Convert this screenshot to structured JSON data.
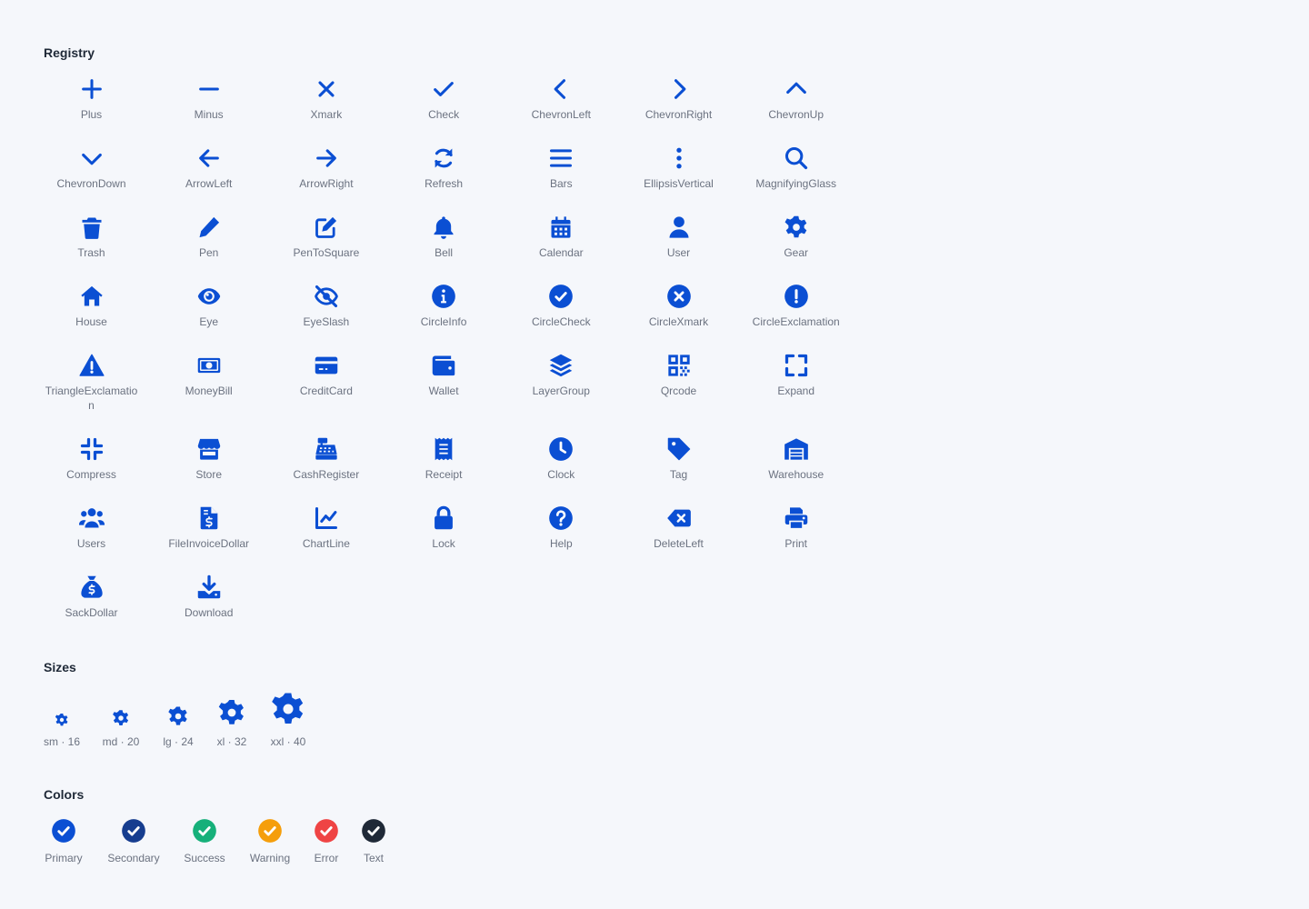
{
  "sections": {
    "registry": "Registry",
    "sizes": "Sizes",
    "colors": "Colors"
  },
  "icon_color": "#0b4fd3",
  "registry": [
    {
      "label": "Plus",
      "icon": "plus-icon"
    },
    {
      "label": "Minus",
      "icon": "minus-icon"
    },
    {
      "label": "Xmark",
      "icon": "xmark-icon"
    },
    {
      "label": "Check",
      "icon": "check-icon"
    },
    {
      "label": "ChevronLeft",
      "icon": "chevron-left-icon"
    },
    {
      "label": "ChevronRight",
      "icon": "chevron-right-icon"
    },
    {
      "label": "ChevronUp",
      "icon": "chevron-up-icon"
    },
    {
      "label": "ChevronDown",
      "icon": "chevron-down-icon"
    },
    {
      "label": "ArrowLeft",
      "icon": "arrow-left-icon"
    },
    {
      "label": "ArrowRight",
      "icon": "arrow-right-icon"
    },
    {
      "label": "Refresh",
      "icon": "refresh-icon"
    },
    {
      "label": "Bars",
      "icon": "bars-icon"
    },
    {
      "label": "EllipsisVertical",
      "icon": "ellipsis-vertical-icon"
    },
    {
      "label": "MagnifyingGlass",
      "icon": "magnifying-glass-icon"
    },
    {
      "label": "Trash",
      "icon": "trash-icon"
    },
    {
      "label": "Pen",
      "icon": "pen-icon"
    },
    {
      "label": "PenToSquare",
      "icon": "pen-to-square-icon"
    },
    {
      "label": "Bell",
      "icon": "bell-icon"
    },
    {
      "label": "Calendar",
      "icon": "calendar-icon"
    },
    {
      "label": "User",
      "icon": "user-icon"
    },
    {
      "label": "Gear",
      "icon": "gear-icon"
    },
    {
      "label": "House",
      "icon": "house-icon"
    },
    {
      "label": "Eye",
      "icon": "eye-icon"
    },
    {
      "label": "EyeSlash",
      "icon": "eye-slash-icon"
    },
    {
      "label": "CircleInfo",
      "icon": "circle-info-icon"
    },
    {
      "label": "CircleCheck",
      "icon": "circle-check-icon"
    },
    {
      "label": "CircleXmark",
      "icon": "circle-xmark-icon"
    },
    {
      "label": "CircleExclamation",
      "icon": "circle-exclamation-icon"
    },
    {
      "label": "TriangleExclamation",
      "icon": "triangle-exclamation-icon"
    },
    {
      "label": "MoneyBill",
      "icon": "money-bill-icon"
    },
    {
      "label": "CreditCard",
      "icon": "credit-card-icon"
    },
    {
      "label": "Wallet",
      "icon": "wallet-icon"
    },
    {
      "label": "LayerGroup",
      "icon": "layer-group-icon"
    },
    {
      "label": "Qrcode",
      "icon": "qrcode-icon"
    },
    {
      "label": "Expand",
      "icon": "expand-icon"
    },
    {
      "label": "Compress",
      "icon": "compress-icon"
    },
    {
      "label": "Store",
      "icon": "store-icon"
    },
    {
      "label": "CashRegister",
      "icon": "cash-register-icon"
    },
    {
      "label": "Receipt",
      "icon": "receipt-icon"
    },
    {
      "label": "Clock",
      "icon": "clock-icon"
    },
    {
      "label": "Tag",
      "icon": "tag-icon"
    },
    {
      "label": "Warehouse",
      "icon": "warehouse-icon"
    },
    {
      "label": "Users",
      "icon": "users-icon"
    },
    {
      "label": "FileInvoiceDollar",
      "icon": "file-invoice-dollar-icon"
    },
    {
      "label": "ChartLine",
      "icon": "chart-line-icon"
    },
    {
      "label": "Lock",
      "icon": "lock-icon"
    },
    {
      "label": "Help",
      "icon": "help-icon"
    },
    {
      "label": "DeleteLeft",
      "icon": "delete-left-icon"
    },
    {
      "label": "Print",
      "icon": "print-icon"
    },
    {
      "label": "SackDollar",
      "icon": "sack-dollar-icon"
    },
    {
      "label": "Download",
      "icon": "download-icon"
    }
  ],
  "sizes": [
    {
      "label": "sm · 16",
      "size": 16
    },
    {
      "label": "md · 20",
      "size": 20
    },
    {
      "label": "lg · 24",
      "size": 24
    },
    {
      "label": "xl · 32",
      "size": 32
    },
    {
      "label": "xxl · 40",
      "size": 40
    }
  ],
  "colors": [
    {
      "label": "Primary",
      "color": "#0b4fd3"
    },
    {
      "label": "Secondary",
      "color": "#163d8f"
    },
    {
      "label": "Success",
      "color": "#16b07a"
    },
    {
      "label": "Warning",
      "color": "#f59e0b"
    },
    {
      "label": "Error",
      "color": "#ef4444"
    },
    {
      "label": "Text",
      "color": "#1f2937"
    }
  ]
}
